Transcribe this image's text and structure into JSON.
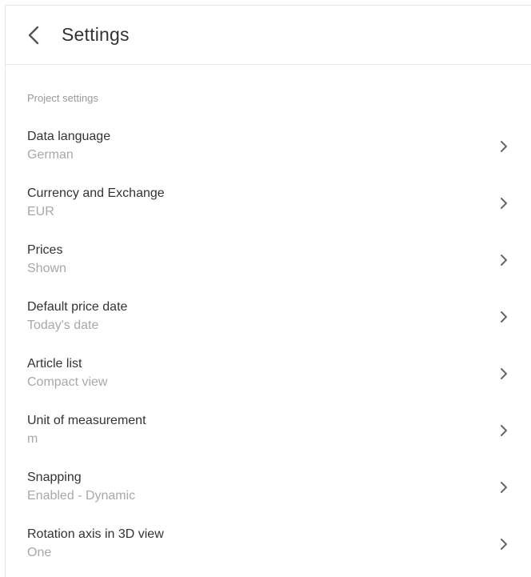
{
  "header": {
    "title": "Settings",
    "back_icon": "chevron-left-icon"
  },
  "section": {
    "label": "Project settings"
  },
  "items": [
    {
      "key": "data-language",
      "label": "Data language",
      "value": "German"
    },
    {
      "key": "currency",
      "label": "Currency and Exchange",
      "value": "EUR"
    },
    {
      "key": "prices",
      "label": "Prices",
      "value": "Shown"
    },
    {
      "key": "default-price-date",
      "label": "Default price date",
      "value": "Today's date"
    },
    {
      "key": "article-list",
      "label": "Article list",
      "value": "Compact view"
    },
    {
      "key": "unit-of-measurement",
      "label": "Unit of measurement",
      "value": "m"
    },
    {
      "key": "snapping",
      "label": "Snapping",
      "value": "Enabled - Dynamic"
    },
    {
      "key": "rotation-axis",
      "label": "Rotation axis in 3D view",
      "value": "One"
    }
  ],
  "colors": {
    "text_primary": "#333333",
    "text_secondary": "#a8a8a8",
    "section_label": "#9a9a9a",
    "divider": "#e6e6e6",
    "chevron": "#666666"
  }
}
